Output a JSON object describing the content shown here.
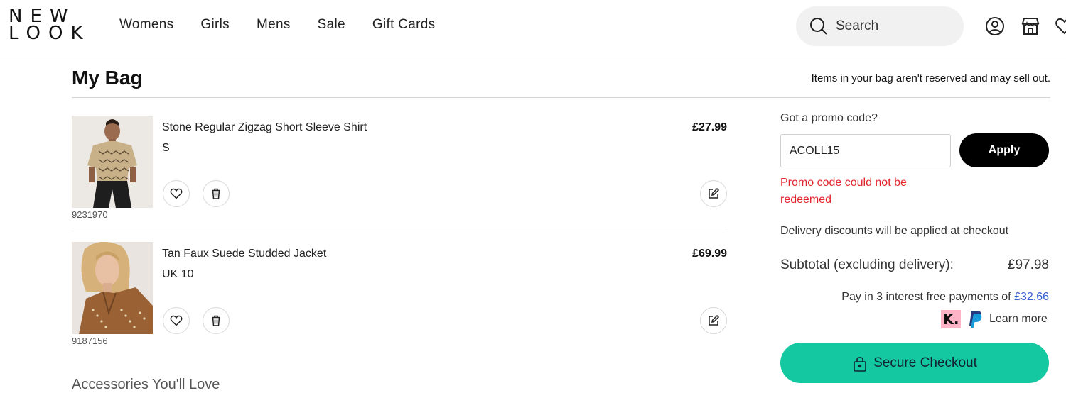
{
  "brand": {
    "line1": "NEW",
    "line2": "LOOK"
  },
  "nav": {
    "items": [
      {
        "label": "Womens"
      },
      {
        "label": "Girls"
      },
      {
        "label": "Mens"
      },
      {
        "label": "Sale"
      },
      {
        "label": "Gift Cards"
      }
    ]
  },
  "header": {
    "search_label": "Search",
    "icons": [
      "search-icon",
      "account-icon",
      "store-icon",
      "wishlist-icon"
    ]
  },
  "page": {
    "title": "My Bag",
    "notice": "Items in your bag aren't reserved and may sell out."
  },
  "bag": {
    "items": [
      {
        "name": "Stone Regular Zigzag Short Sleeve Shirt",
        "size": "S",
        "price": "£27.99",
        "sku": "9231970"
      },
      {
        "name": "Tan Faux Suede Studded Jacket",
        "size": "UK 10",
        "price": "£69.99",
        "sku": "9187156"
      }
    ],
    "accessories_heading": "Accessories You'll Love"
  },
  "summary": {
    "promo_label": "Got a promo code?",
    "promo_value": "ACOLL15",
    "apply_label": "Apply",
    "promo_error": "Promo code could not be redeemed",
    "delivery_note": "Delivery discounts will be applied at checkout",
    "subtotal_label": "Subtotal (excluding delivery):",
    "subtotal_value": "£97.98",
    "pay_in3_text": "Pay in 3 interest free payments of",
    "pay_in3_amount": "£32.66",
    "klarna_mark": "K.",
    "learn_more": "Learn more",
    "checkout_label": "Secure Checkout"
  },
  "colors": {
    "checkout": "#14c9a1",
    "error": "#e3262c",
    "link_amount": "#3c62d6",
    "klarna": "#ffb3c7"
  }
}
